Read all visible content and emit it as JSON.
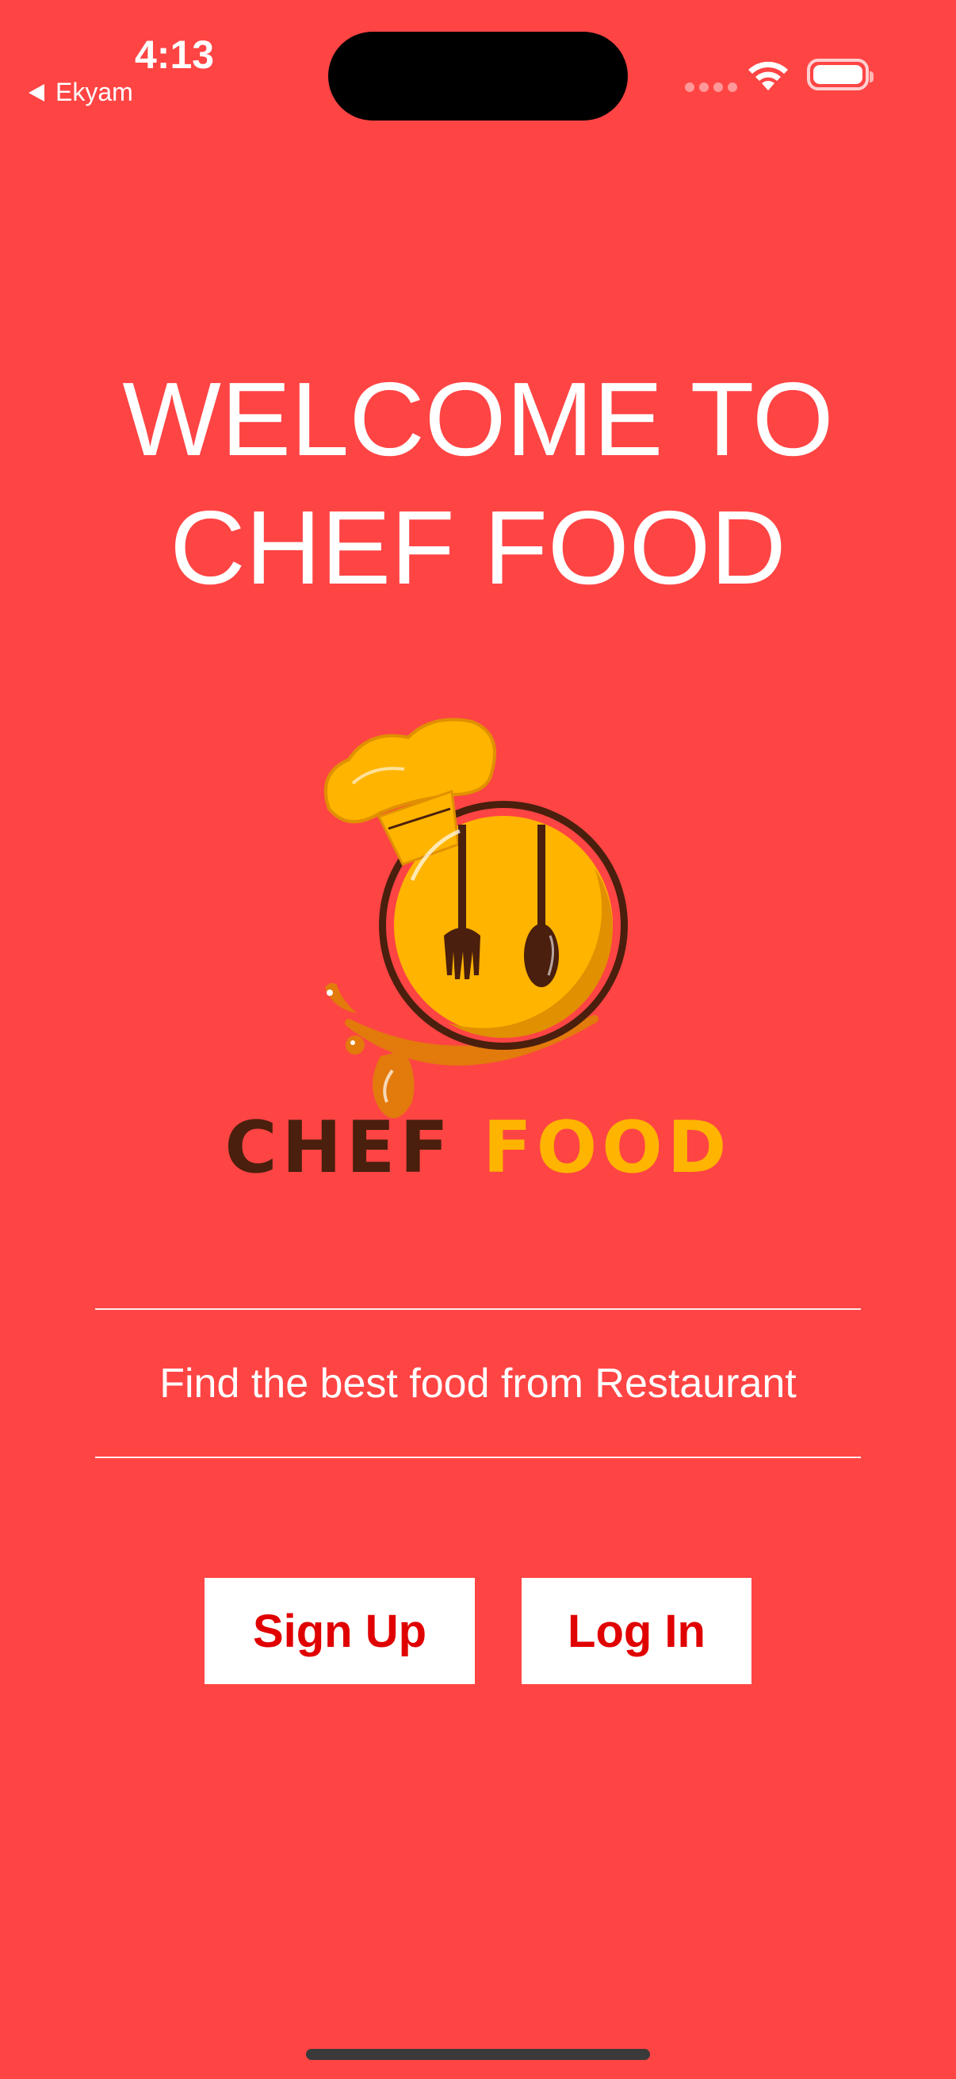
{
  "colors": {
    "background": "#ff4444",
    "text": "#ffffff",
    "button_text": "#e00000",
    "button_bg": "#ffffff",
    "logo_yellow": "#ffb400",
    "logo_brown": "#4a1f0d",
    "logo_orange": "#e27a0c",
    "island": "#000000",
    "home_indicator": "#3a3a3a"
  },
  "status_bar": {
    "time": "4:13",
    "back_app": "Ekyam",
    "icons": [
      "signal-dots-icon",
      "wifi-icon",
      "battery-icon"
    ]
  },
  "welcome": {
    "line1": "WELCOME TO",
    "line2": "CHEF FOOD"
  },
  "logo": {
    "icon": "chef-hat-plate-fork-spoon-logo",
    "word1": "CHEF",
    "word2": "FOOD"
  },
  "tagline": "Find the best food from Restaurant",
  "buttons": {
    "signup": "Sign Up",
    "login": "Log In"
  }
}
